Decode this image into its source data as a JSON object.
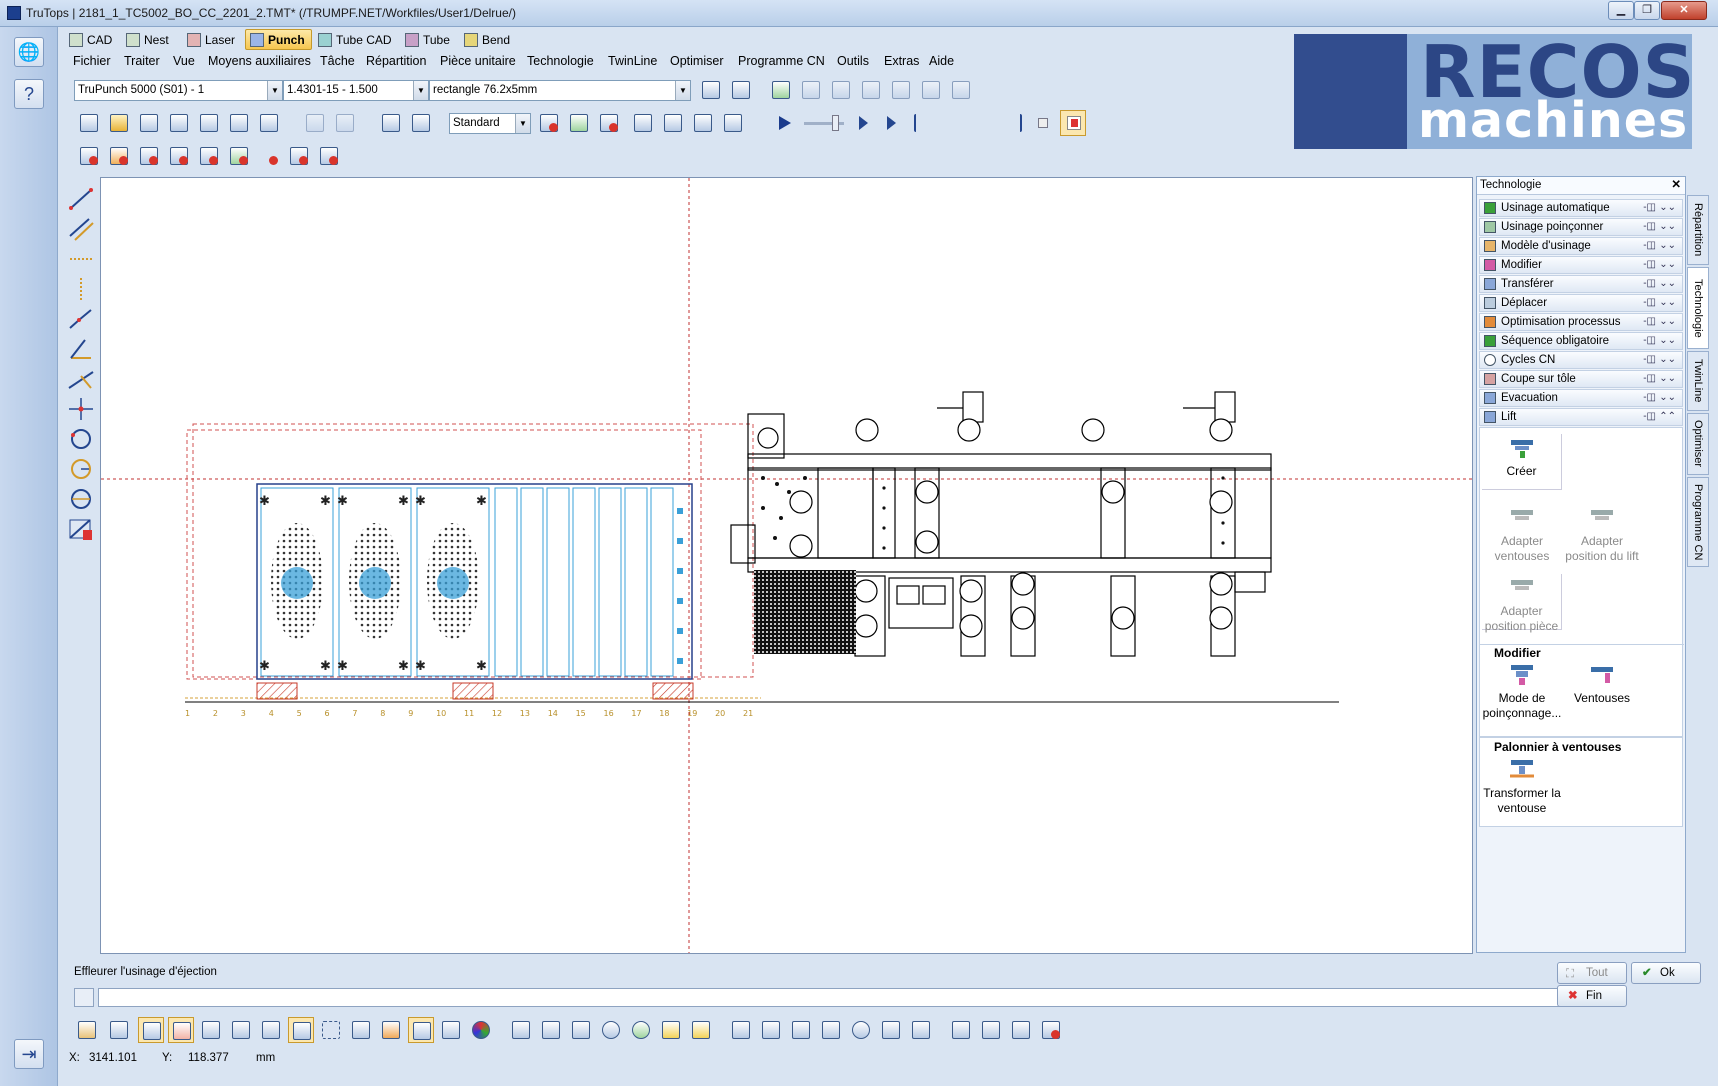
{
  "window": {
    "title": "TruTops | 2181_1_TC5002_BO_CC_2201_2.TMT* (/TRUMPF.NET/Workfiles/User1/Delrue/)",
    "minimize": "▁",
    "maximize": "❐",
    "close": "✕"
  },
  "mode_tabs": [
    {
      "label": "CAD"
    },
    {
      "label": "Nest"
    },
    {
      "label": "Laser"
    },
    {
      "label": "Punch",
      "active": true
    },
    {
      "label": "Tube CAD"
    },
    {
      "label": "Tube"
    },
    {
      "label": "Bend"
    }
  ],
  "menu": [
    "Fichier",
    "Traiter",
    "Vue",
    "Moyens auxiliaires",
    "Tâche",
    "Répartition",
    "Pièce unitaire",
    "Technologie",
    "TwinLine",
    "Optimiser",
    "Programme CN",
    "Outils",
    "Extras",
    "Aide"
  ],
  "toolbar": {
    "machine": "TruPunch 5000 (S01) - 1",
    "material": "1.4301-15 - 1.500",
    "tool": "rectangle 76.2x5mm",
    "strategy": "Standard"
  },
  "logo": {
    "line1": "RECOS",
    "line2": "machines"
  },
  "panel": {
    "title": "Technologie",
    "sections": [
      "Usinage automatique",
      "Usinage poinçonner",
      "Modèle d'usinage",
      "Modifier",
      "Transférer",
      "Déplacer",
      "Optimisation processus",
      "Séquence obligatoire",
      "Cycles CN",
      "Coupe sur tôle",
      "Evacuation",
      "Lift"
    ],
    "lift": {
      "create": "Créer",
      "adapt_cups": "Adapter ventouses",
      "adapt_lift": "Adapter position du lift",
      "adapt_part": "Adapter position pièce",
      "group_modify": "Modifier",
      "punch_mode": "Mode de poinçonnage...",
      "cups": "Ventouses",
      "group_beam": "Palonnier à ventouses",
      "transform": "Transformer la ventouse"
    },
    "side_tabs": [
      "Répartition",
      "Technologie",
      "TwinLine",
      "Optimiser",
      "Programme CN"
    ]
  },
  "command": {
    "prompt": "Effleurer l'usinage d'éjection",
    "input": "",
    "btn_all": "Tout",
    "btn_ok": "Ok",
    "btn_end": "Fin"
  },
  "status": {
    "x_label": "X:",
    "x": "3141.101",
    "y_label": "Y:",
    "y": "118.377",
    "unit": "mm"
  },
  "ruler_labels": [
    "1",
    "2",
    "3",
    "4",
    "5",
    "6",
    "7",
    "8",
    "9",
    "10",
    "11",
    "12",
    "13",
    "14",
    "15",
    "16",
    "17",
    "18",
    "19",
    "20",
    "21"
  ],
  "colors": {
    "accent": "#f6c650",
    "brand": "#324d8e",
    "cad_line": "#000000",
    "sheet_outline": "#d03030",
    "part_fill": "#3aa0d8"
  }
}
